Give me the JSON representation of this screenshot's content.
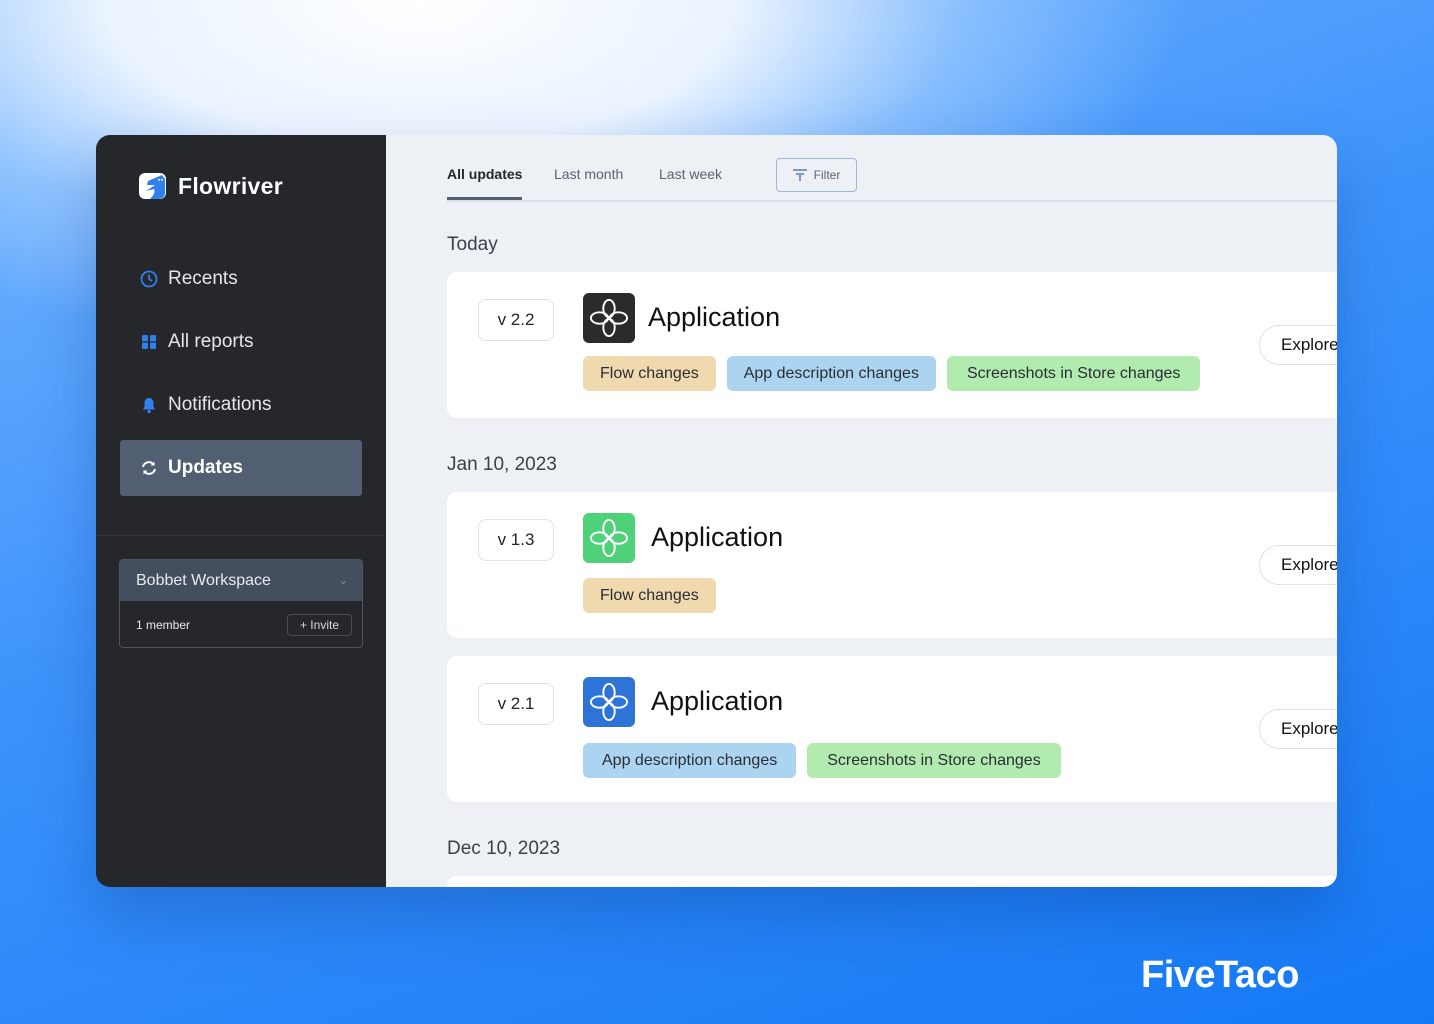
{
  "app": {
    "name": "Flowriver"
  },
  "sidebar": {
    "items": [
      {
        "label": "Recents",
        "icon": "clock-icon"
      },
      {
        "label": "All reports",
        "icon": "reports-icon"
      },
      {
        "label": "Notifications",
        "icon": "bell-icon"
      },
      {
        "label": "Updates",
        "icon": "refresh-icon",
        "active": true
      }
    ],
    "workspace": {
      "name": "Bobbet Workspace",
      "members": "1 member",
      "invite_label": "+ Invite"
    }
  },
  "tabs": [
    {
      "label": "All updates",
      "active": true
    },
    {
      "label": "Last month"
    },
    {
      "label": "Last week"
    }
  ],
  "filter_label": "Filter",
  "groups": [
    {
      "date": "Today",
      "cards": [
        {
          "version": "v 2.2",
          "title": "Application",
          "icon_color": "#2b2b2b",
          "tags": [
            {
              "label": "Flow changes",
              "color": "#f0d9ae"
            },
            {
              "label": "App description changes",
              "color": "#acd4f0"
            },
            {
              "label": "Screenshots in Store changes",
              "color": "#b2ebb0"
            }
          ],
          "action": "Explore"
        }
      ]
    },
    {
      "date": "Jan 10, 2023",
      "cards": [
        {
          "version": "v 1.3",
          "title": "Application",
          "icon_color": "#4fd17a",
          "tags": [
            {
              "label": "Flow changes",
              "color": "#f0d9ae"
            }
          ],
          "action": "Explore"
        },
        {
          "version": "v 2.1",
          "title": "Application",
          "icon_color": "#2e74d6",
          "tags": [
            {
              "label": "App description changes",
              "color": "#acd4f0"
            },
            {
              "label": "Screenshots in Store changes",
              "color": "#b2ebb0"
            }
          ],
          "action": "Explore"
        }
      ]
    },
    {
      "date": "Dec 10, 2023",
      "cards": []
    }
  ],
  "footer_brand": "FiveTaco",
  "colors": {
    "sidebar": "#25272b",
    "active_nav": "#525e72",
    "accent": "#2f80ed"
  }
}
